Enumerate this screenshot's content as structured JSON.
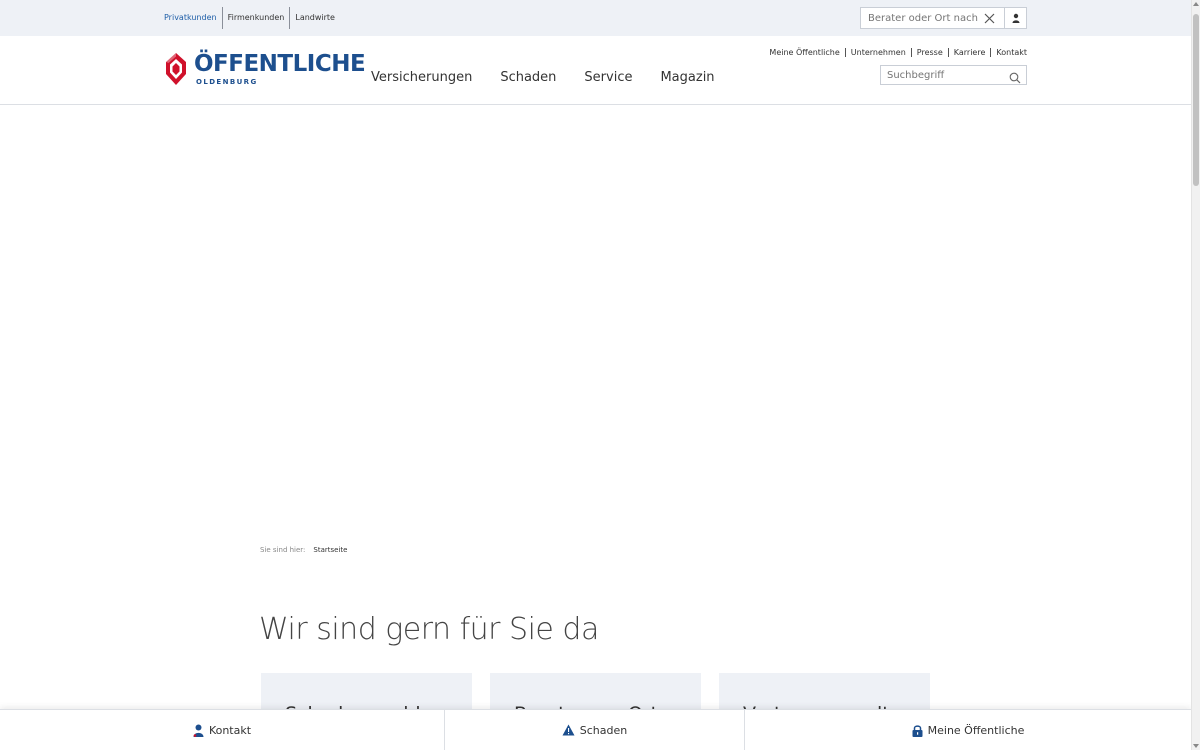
{
  "colors": {
    "brand_blue": "#1d4f8e",
    "brand_red": "#d0112b",
    "link_blue": "#1f5fa8",
    "topbar_bg": "#eef1f6",
    "card_bg": "#eef1f6"
  },
  "topbar": {
    "segments": [
      "Privatkunden",
      "Firmenkunden",
      "Landwirte"
    ],
    "active_segment": "Privatkunden",
    "advisor_search": {
      "placeholder": "Berater oder Ort nach Klic",
      "clear_icon": "close-icon",
      "user_icon": "user-icon"
    }
  },
  "header": {
    "logo": {
      "name": "ÖFFENTLICHE",
      "sub": "OLDENBURG",
      "icon": "shield-logo-icon"
    },
    "main_nav": [
      "Versicherungen",
      "Schaden",
      "Service",
      "Magazin"
    ],
    "meta_nav": [
      "Meine Öffentliche",
      "Unternehmen",
      "Presse",
      "Karriere",
      "Kontakt"
    ],
    "search": {
      "placeholder": "Suchbegriff",
      "icon": "search-icon"
    }
  },
  "breadcrumb": {
    "prefix": "Sie sind hier:",
    "current": "Startseite"
  },
  "main": {
    "headline": "Wir sind gern für Sie da",
    "cards": [
      "Schaden melden",
      "Berater vor Ort",
      "Vertrag verwalten"
    ]
  },
  "bottombar": {
    "items": [
      {
        "label": "Kontakt",
        "icon": "person-icon"
      },
      {
        "label": "Schaden",
        "icon": "warning-icon"
      },
      {
        "label": "Meine Öffentliche",
        "icon": "lock-icon"
      }
    ]
  }
}
